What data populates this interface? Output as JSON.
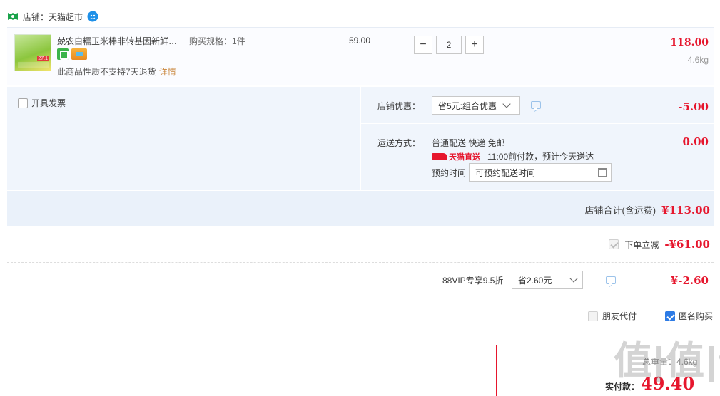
{
  "shop": {
    "label": "店铺：天猫超市",
    "icon": "shop-icon",
    "chat_icon": "wangwang-icon",
    "color": "#1aa34a"
  },
  "item": {
    "title": "兢农白糯玉米棒非转基因新鲜采摘甜玉米",
    "spec": "购买规格：1件",
    "badges": [
      "service-green-badge",
      "card-badge"
    ],
    "return_note": "此商品性质不支持7天退货",
    "detail_link": "详情",
    "unit_price": "59.00",
    "quantity": "2",
    "minus": "−",
    "plus": "+",
    "subtotal": "118.00",
    "weight": "4.6kg",
    "image_label": "27.1"
  },
  "invoice": {
    "label": "开具发票"
  },
  "shop_discount": {
    "label": "店铺优惠：",
    "selected": "省5元:组合优惠",
    "amount": "-5.00"
  },
  "shipping": {
    "label": "运送方式：",
    "method": "普通配送 快递 免邮",
    "tmall_tag": "天猫直送",
    "eta": "11:00前付款，预计今天送达",
    "appointment_label": "预约时间",
    "appointment_placeholder": "可预约配送时间",
    "amount": "0.00"
  },
  "shop_total": {
    "label": "店铺合计(含运费)",
    "amount": "¥113.00"
  },
  "instant_discount": {
    "label": "下单立减",
    "amount": "-¥61.00"
  },
  "vip": {
    "label": "88VIP专享9.5折",
    "selected": "省2.60元",
    "amount": "¥-2.60"
  },
  "options": {
    "friend_pay": "朋友代付",
    "anonymous": "匿名购买"
  },
  "payment": {
    "weight_label": "总重量：4.6kg",
    "pay_label": "实付款：",
    "amount": "49.40"
  },
  "watermark": "值|值|值",
  "colors": {
    "price_red": "#e6162d",
    "panel_blue": "#f0f5fc",
    "checkbox_blue": "#2d7be5"
  }
}
